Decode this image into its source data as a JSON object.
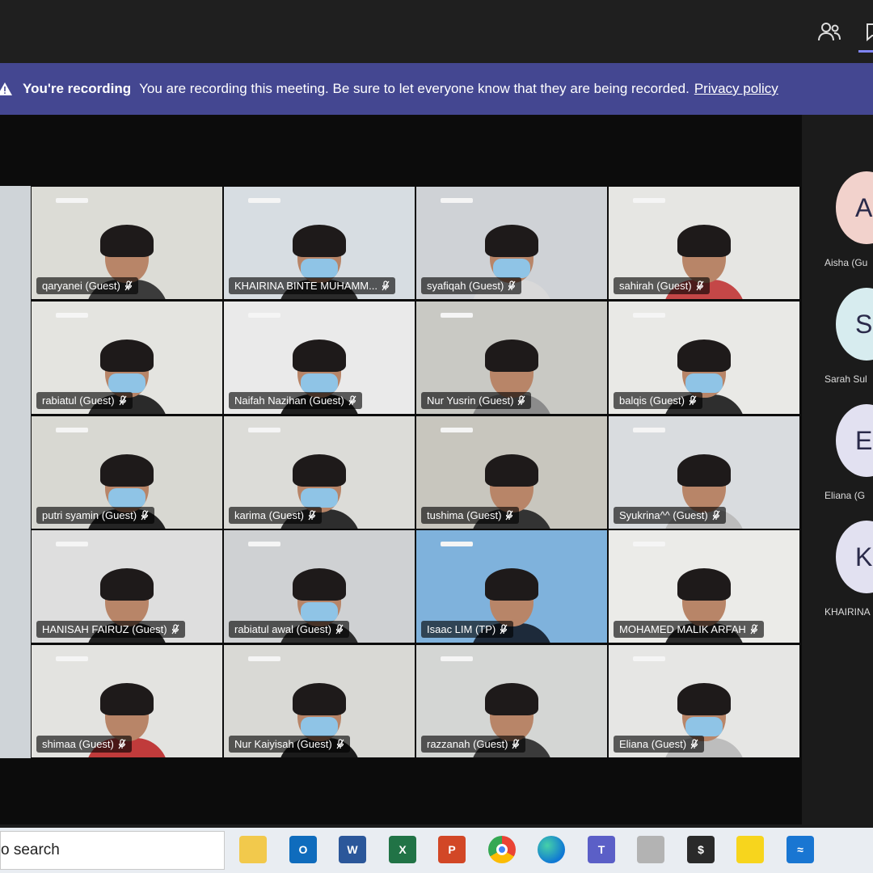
{
  "banner": {
    "title": "You're recording",
    "message": "You are recording this meeting. Be sure to let everyone know that they are being recorded.",
    "privacy_link": "Privacy policy"
  },
  "tiles": [
    {
      "name": "qaryanei (Guest)",
      "bg": "#dcdcd6",
      "shirt": "#3b3b3b",
      "mask": false
    },
    {
      "name": "KHAIRINA BINTE MUHAMM...",
      "bg": "#d7dde2",
      "shirt": "#2a2a2a",
      "mask": true
    },
    {
      "name": "syafiqah (Guest)",
      "bg": "#cfd2d6",
      "shirt": "#d9d9d9",
      "mask": true
    },
    {
      "name": "sahirah (Guest)",
      "bg": "#e6e6e3",
      "shirt": "#c44747",
      "mask": false
    },
    {
      "name": "rabiatul (Guest)",
      "bg": "#e4e4e0",
      "shirt": "#2a2a2a",
      "mask": true
    },
    {
      "name": "Naifah Nazihan (Guest)",
      "bg": "#eaeaea",
      "shirt": "#1f1f1f",
      "mask": true
    },
    {
      "name": "Nur Yusrin (Guest)",
      "bg": "#c9c9c4",
      "shirt": "#8b8b8b",
      "mask": false
    },
    {
      "name": "balqis (Guest)",
      "bg": "#e9e9e6",
      "shirt": "#2e2e2e",
      "mask": true
    },
    {
      "name": "putri syamin (Guest)",
      "bg": "#d8d8d2",
      "shirt": "#242424",
      "mask": true
    },
    {
      "name": "karima (Guest)",
      "bg": "#dcdcd8",
      "shirt": "#2d2d2d",
      "mask": true
    },
    {
      "name": "tushima (Guest)",
      "bg": "#c8c6be",
      "shirt": "#333333",
      "mask": false
    },
    {
      "name": "Syukrina^^ (Guest)",
      "bg": "#d9dcdf",
      "shirt": "#bcbcbc",
      "mask": false
    },
    {
      "name": "HANISAH FAIRUZ (Guest)",
      "bg": "#dedede",
      "shirt": "#202020",
      "mask": false
    },
    {
      "name": "rabiatul awal (Guest)",
      "bg": "#cfd1d3",
      "shirt": "#2d2d2d",
      "mask": true
    },
    {
      "name": "Isaac LIM (TP)",
      "bg": "#7fb2dc",
      "shirt": "#1d2a3a",
      "mask": false
    },
    {
      "name": "MOHAMED MALIK ARFAH",
      "bg": "#ebebe8",
      "shirt": "#2b2b2b",
      "mask": false
    },
    {
      "name": "shimaa (Guest)",
      "bg": "#e3e3e0",
      "shirt": "#c03b3b",
      "mask": false
    },
    {
      "name": "Nur Kaiyisah (Guest)",
      "bg": "#d9d9d5",
      "shirt": "#1b1b1b",
      "mask": true
    },
    {
      "name": "razzanah (Guest)",
      "bg": "#d4d6d4",
      "shirt": "#3a3a3a",
      "mask": false
    },
    {
      "name": "Eliana (Guest)",
      "bg": "#e6e6e4",
      "shirt": "#bdbdbd",
      "mask": true
    }
  ],
  "roster": [
    {
      "initials": "A",
      "name": "Aisha (Gu",
      "color": "#f2d2cc"
    },
    {
      "initials": "S:",
      "name": "Sarah Sul",
      "color": "#d7ecef"
    },
    {
      "initials": "E",
      "name": "Eliana (G",
      "color": "#e2e1f1"
    },
    {
      "initials": "K",
      "name": "KHAIRINA",
      "color": "#e2e1f1"
    }
  ],
  "taskbar": {
    "search_placeholder": "o search",
    "apps": [
      {
        "icon": "file-explorer-icon",
        "label": "",
        "color": "#f2c94c"
      },
      {
        "icon": "outlook-icon",
        "label": "O",
        "color": "#0f6cbd"
      },
      {
        "icon": "word-icon",
        "label": "W",
        "color": "#2b579a"
      },
      {
        "icon": "excel-icon",
        "label": "X",
        "color": "#217346"
      },
      {
        "icon": "powerpoint-icon",
        "label": "P",
        "color": "#d24726"
      },
      {
        "icon": "chrome-icon",
        "label": "",
        "color": "#e8453c"
      },
      {
        "icon": "edge-icon",
        "label": "",
        "color": "#1f9ede"
      },
      {
        "icon": "teams-icon",
        "label": "T",
        "color": "#5b5fc7"
      },
      {
        "icon": "network-icon",
        "label": "",
        "color": "#b3b3b3"
      },
      {
        "icon": "dollar-app-icon",
        "label": "$",
        "color": "#2a2a2a"
      },
      {
        "icon": "sticky-notes-icon",
        "label": "",
        "color": "#f7d51d"
      },
      {
        "icon": "blue-app-icon",
        "label": "≈",
        "color": "#1976d2"
      }
    ]
  }
}
